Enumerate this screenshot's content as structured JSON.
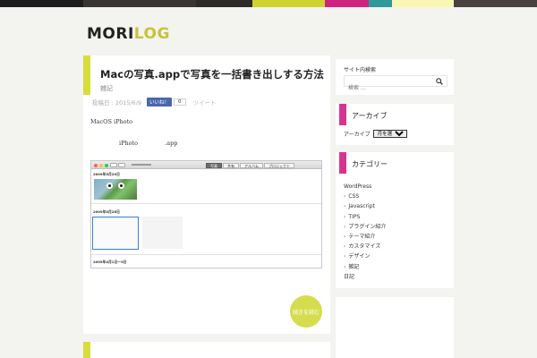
{
  "colors": {
    "bg": "#f3f3ef",
    "accent_green": "#d8dc3c",
    "accent_pink": "#d4358f",
    "topbar": [
      "#1e1e1e",
      "#3a3532",
      "#2f2b28",
      "#cfd22f",
      "#d2227f",
      "#31999a",
      "#faf7b4",
      "#4a4240"
    ]
  },
  "site": {
    "logo_part1": "MORI",
    "logo_part2": "LOG"
  },
  "post": {
    "title": "Macの写真.appで写真を一括書き出しする方法",
    "category": "雑記",
    "date": "投稿日 : 2015/6/9",
    "like_label": "いいね！",
    "like_count": "0",
    "tweet_label": "ツイート",
    "para1": "MacOS iPhoto",
    "para2": "iPhoto .app",
    "readmore": "続きを読む"
  },
  "shot": {
    "tabs": [
      "写真",
      "共有",
      "アルバム",
      "プロジェクト"
    ],
    "section1": "2009年5月20日",
    "section2": "2009年5月28日",
    "section3": "2009年4月1日〜3日"
  },
  "sidebar": {
    "search_title": "サイト内検索",
    "search_placeholder": "検索 ...",
    "archive_title": "アーカイブ",
    "archive_label": "アーカイブ",
    "archive_select": "月を選択",
    "category_title": "カテゴリー",
    "categories": [
      {
        "label": "WordPress",
        "child": false
      },
      {
        "label": "CSS",
        "child": true
      },
      {
        "label": "Javascript",
        "child": true
      },
      {
        "label": "TIPS",
        "child": true
      },
      {
        "label": "プラグイン紹介",
        "child": true
      },
      {
        "label": "テーマ紹介",
        "child": true
      },
      {
        "label": "カスタマイズ",
        "child": true
      },
      {
        "label": "デザイン",
        "child": true
      },
      {
        "label": "雑記",
        "child": true
      },
      {
        "label": "日記",
        "child": false
      }
    ]
  }
}
